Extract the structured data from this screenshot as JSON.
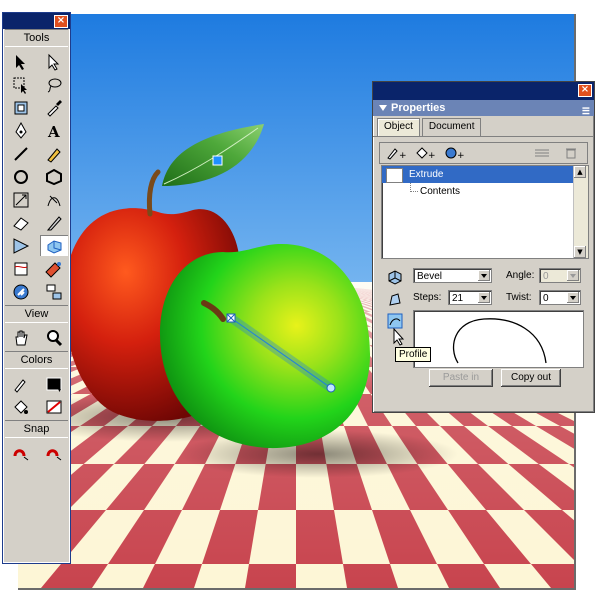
{
  "colors": {
    "sky_top": "#1e7be0",
    "sky_bottom": "#dbeeff",
    "check_red": "#c8444e",
    "check_cream": "#fdf6d6",
    "red_apple": "#c4180e",
    "green_apple": "#22d41a",
    "leaf": "#3a9a2a",
    "titlebar": "#0a246a",
    "panel_header": "#6b84b6",
    "selection": "#316ac5"
  },
  "tools_palette": {
    "title": "Tools",
    "view_label": "View",
    "colors_label": "Colors",
    "snap_label": "Snap",
    "close_icon": "x-icon"
  },
  "properties_panel": {
    "title": "Properties",
    "tabs": [
      "Object",
      "Document"
    ],
    "list_items": [
      "Extrude",
      "Contents"
    ],
    "type_value": "Bevel",
    "angle_label": "Angle:",
    "angle_value": "0",
    "steps_label": "Steps:",
    "steps_value": "21",
    "twist_label": "Twist:",
    "twist_value": "0",
    "paste_in_label": "Paste in",
    "copy_out_label": "Copy out",
    "tooltip": "Profile"
  }
}
